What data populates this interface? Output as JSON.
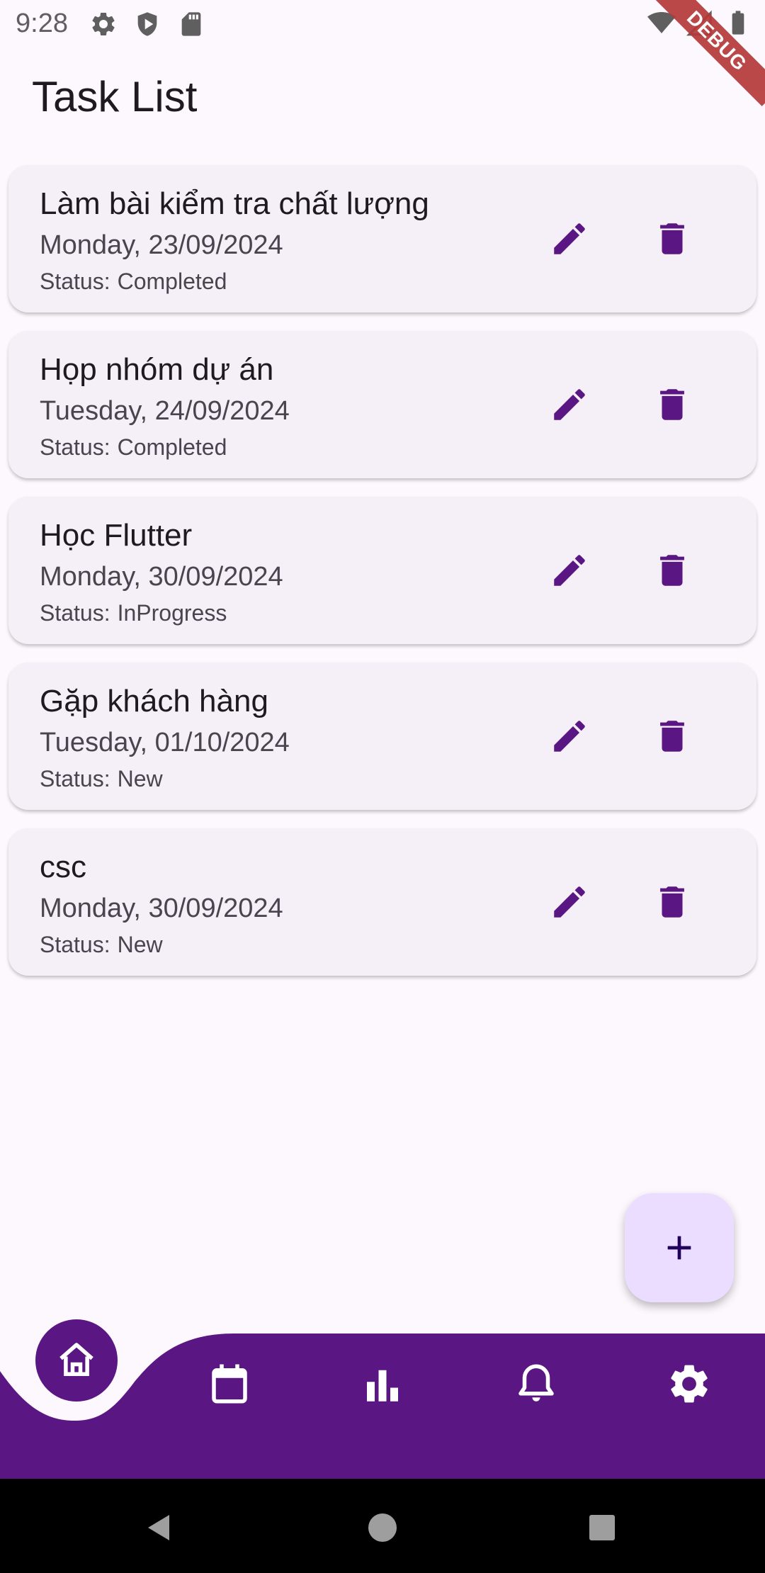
{
  "status_bar": {
    "time": "9:28",
    "left_icons": [
      "gear-icon",
      "shield-play-icon",
      "sd-card-icon"
    ],
    "right_icons": [
      "wifi-icon",
      "signal-icon",
      "battery-icon"
    ]
  },
  "debug_banner": "DEBUG",
  "header": {
    "title": "Task List"
  },
  "tasks": [
    {
      "title": "Làm bài kiểm tra chất lượng",
      "date": "Monday, 23/09/2024",
      "status_label": "Status:",
      "status": "Completed"
    },
    {
      "title": "Họp nhóm dự án",
      "date": "Tuesday, 24/09/2024",
      "status_label": "Status:",
      "status": "Completed"
    },
    {
      "title": "Học Flutter",
      "date": "Monday, 30/09/2024",
      "status_label": "Status:",
      "status": "InProgress"
    },
    {
      "title": "Gặp khách hàng",
      "date": "Tuesday, 01/10/2024",
      "status_label": "Status:",
      "status": "New"
    },
    {
      "title": "csc",
      "date": "Monday, 30/09/2024",
      "status_label": "Status:",
      "status": "New"
    }
  ],
  "task_actions": [
    "edit-icon",
    "delete-icon"
  ],
  "fab": {
    "icon": "plus-icon"
  },
  "bottom_nav": {
    "items": [
      "home-icon",
      "calendar-icon",
      "bar-chart-icon",
      "bell-icon",
      "settings-icon"
    ],
    "selected": "home-icon"
  },
  "system_nav": [
    "back-icon",
    "home-circle-icon",
    "recents-icon"
  ],
  "colors": {
    "background": "#fdf7fe",
    "card": "#f5eff8",
    "accent": "#5a1682",
    "fab": "#eaddff",
    "debug": "#b53a3a"
  }
}
